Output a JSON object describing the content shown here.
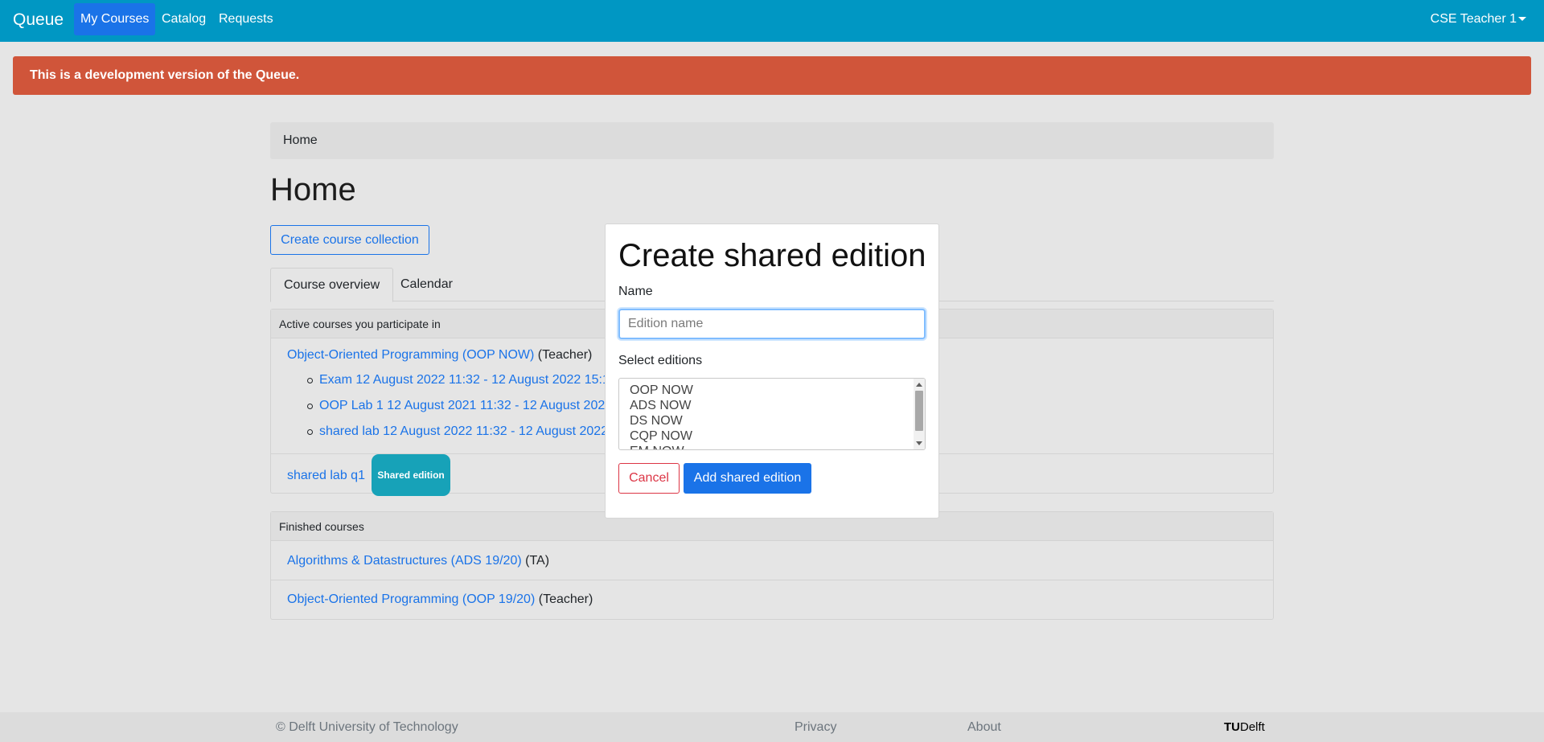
{
  "navbar": {
    "brand": "Queue",
    "items": [
      {
        "label": "My Courses",
        "active": true
      },
      {
        "label": "Catalog",
        "active": false
      },
      {
        "label": "Requests",
        "active": false
      }
    ],
    "user": "CSE Teacher 1"
  },
  "banner": {
    "text": "This is a development version of the Queue.",
    "color": "#d0553a"
  },
  "breadcrumb": {
    "home": "Home"
  },
  "page": {
    "title": "Home",
    "create_collection_label": "Create course collection",
    "tabs": [
      "Course overview",
      "Calendar"
    ]
  },
  "active_courses": {
    "header": "Active courses you participate in",
    "course": {
      "name": "Object-Oriented Programming (OOP NOW)",
      "role": "(Teacher)"
    },
    "sessions": [
      "Exam 12 August 2022 11:32 - 12 August 2022 15:1",
      "OOP Lab 1 12 August 2021 11:32 - 12 August 202",
      "shared lab 12 August 2022 11:32 - 12 August 2022"
    ],
    "shared": {
      "name": "shared lab q1",
      "badge": "Shared edition"
    }
  },
  "finished_courses": {
    "header": "Finished courses",
    "rows": [
      {
        "name": "Algorithms & Datastructures (ADS 19/20)",
        "role": "(TA)"
      },
      {
        "name": "Object-Oriented Programming (OOP 19/20)",
        "role": "(Teacher)"
      }
    ]
  },
  "footer": {
    "copyright": "© Delft University of Technology",
    "privacy": "Privacy",
    "about": "About",
    "logo_tu": "TU",
    "logo_delft": "Delft"
  },
  "modal": {
    "title": "Create shared edition",
    "name_label": "Name",
    "name_placeholder": "Edition name",
    "name_value": "",
    "select_label": "Select editions",
    "options": [
      "OOP NOW",
      "ADS NOW",
      "DS NOW",
      "CQP NOW",
      "EM NOW"
    ],
    "cancel_label": "Cancel",
    "add_label": "Add shared edition"
  },
  "colors": {
    "navbar": "#0097c3",
    "primary": "#1a73e8",
    "danger": "#dc3545",
    "badge": "#17a2b8"
  }
}
